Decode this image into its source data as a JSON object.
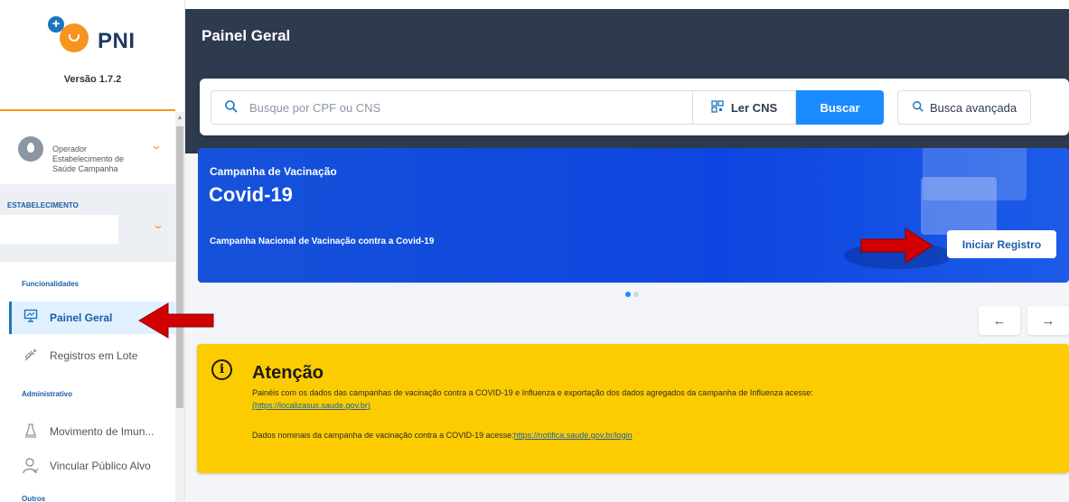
{
  "sidebar": {
    "logo_text": "PNI",
    "version": "Versão 1.7.2",
    "operator_lines": [
      "Operador",
      "Estabelecimento de",
      "Saúde Campanha"
    ],
    "estab_label": "ESTABELECIMENTO",
    "sections": {
      "funcionalidades": "Funcionalidades",
      "administrativo": "Administrativo",
      "outros": "Outros"
    },
    "items": [
      {
        "label": "Painel Geral",
        "icon": "dashboard-icon",
        "active": true
      },
      {
        "label": "Registros em Lote",
        "icon": "syringe-icon"
      },
      {
        "label": "Movimento de Imun...",
        "icon": "vaccine-flask-icon"
      },
      {
        "label": "Vincular Público Alvo",
        "icon": "user-link-icon"
      }
    ]
  },
  "header": {
    "title": "Painel Geral"
  },
  "search": {
    "placeholder": "Busque por CPF ou CNS",
    "ler_cns": "Ler CNS",
    "buscar": "Buscar",
    "busca_avancada": "Busca avançada"
  },
  "banner": {
    "subtitle": "Campanha de Vacinação",
    "title": "Covid-19",
    "description": "Campanha Nacional de Vacinação contra a Covid-19",
    "button": "Iniciar Registro"
  },
  "carousel": {
    "prev": "←",
    "next": "→",
    "slides": 2,
    "active": 1
  },
  "attention": {
    "title": "Atenção",
    "line1": "Painéis com os dados das campanhas de vacinação contra a COVID-19 e Influenza e exportação dos dados agregados da campanha de Influenza acesse:",
    "link1": "(https://localizasus.saude.gov.br)",
    "line3_prefix": "Dados nominais da campanha de vacinação contra a COVID-19 acesse:",
    "link2": "https://notifica.saude.gov.br/login"
  },
  "colors": {
    "header": "#2e3b4e",
    "accent": "#1a8cff",
    "banner": "#0d45e0",
    "attention": "#fdcc00",
    "brand_orange": "#f7941d",
    "annotation_red": "#d10000"
  }
}
